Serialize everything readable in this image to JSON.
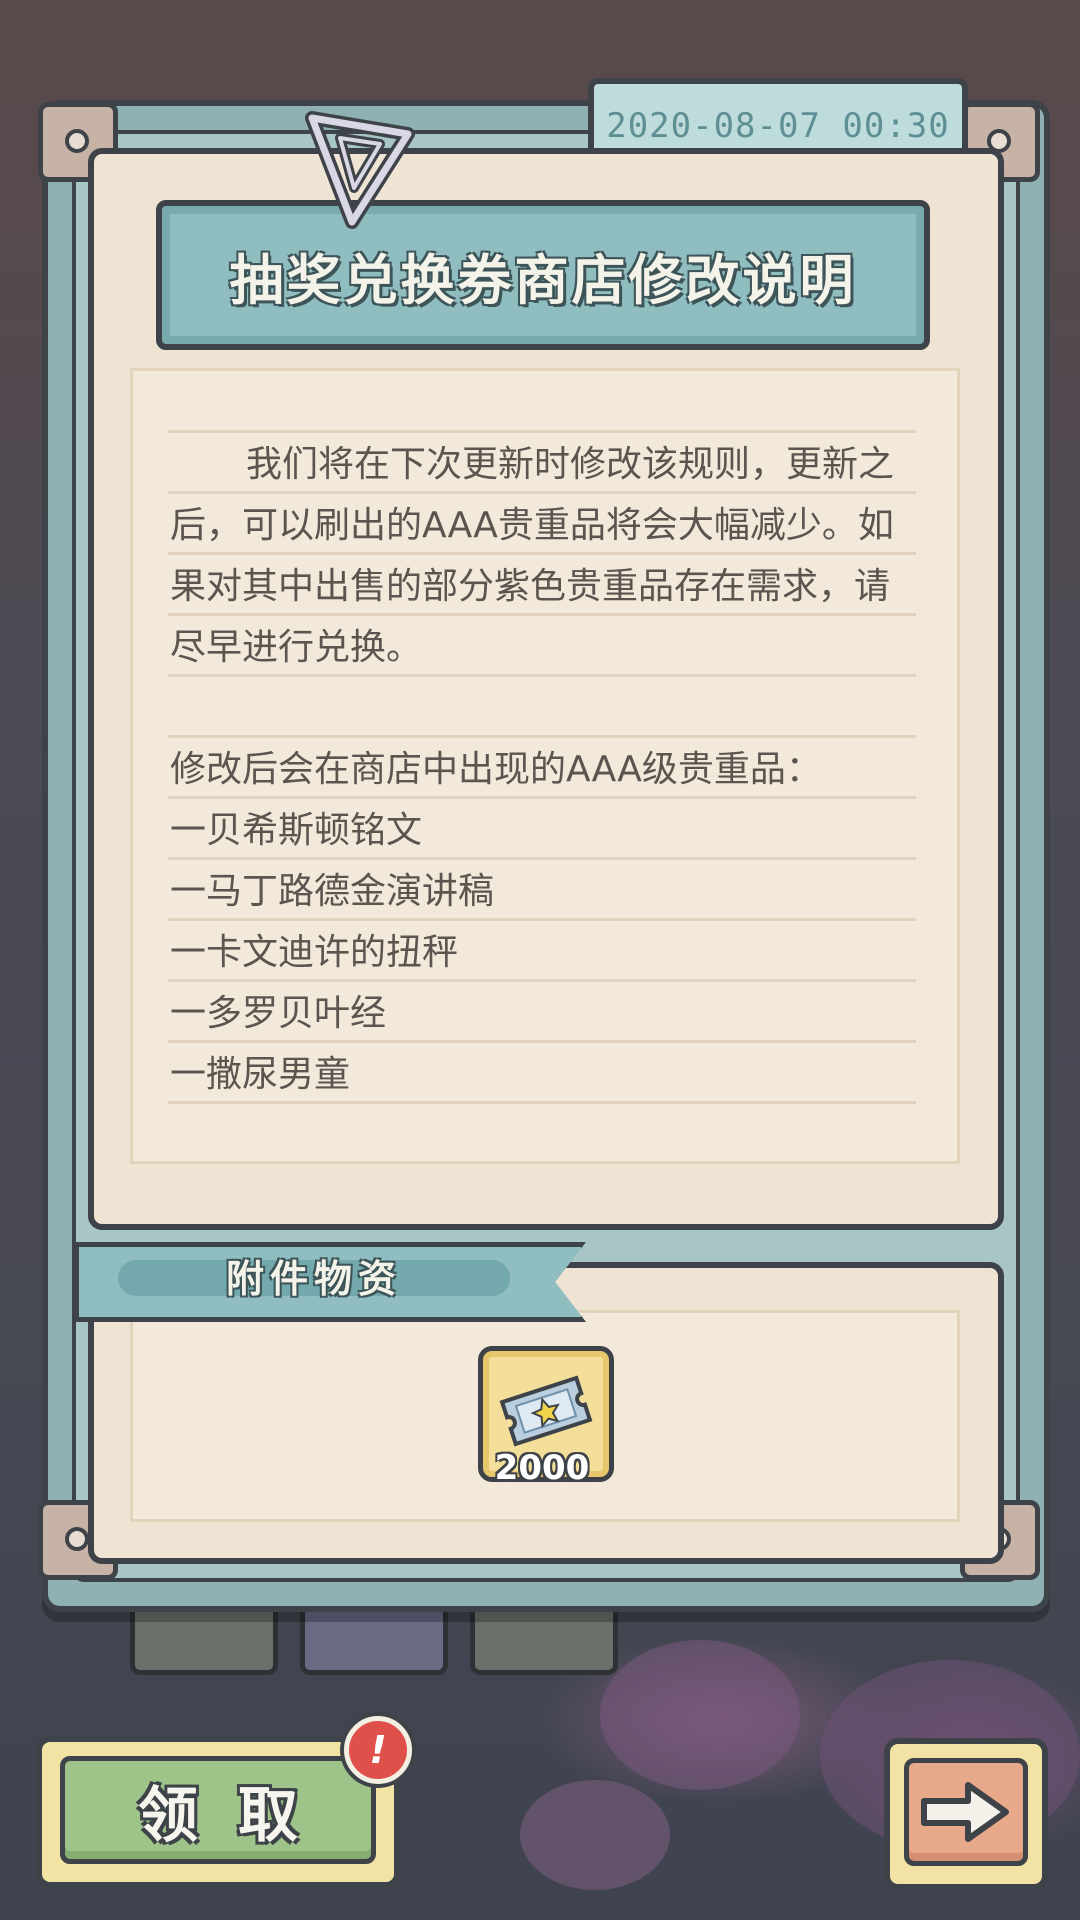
{
  "mail": {
    "date": "2020-08-07  00:30",
    "title": "抽奖兑换券商店修改说明",
    "body": {
      "para1": [
        "我们将在下次更新时修改该规则，更新之",
        "后，可以刷出的AAA贵重品将会大幅减少。如",
        "果对其中出售的部分紫色贵重品存在需求，请",
        "尽早进行兑换。"
      ],
      "list_heading": "修改后会在商店中出现的AAA级贵重品：",
      "list_items": [
        "一贝希斯顿铭文",
        "一马丁路德金演讲稿",
        "一卡文迪许的扭秤",
        "一多罗贝叶经",
        "一撒尿男童"
      ]
    },
    "attachments": {
      "label": "附件物资",
      "items": [
        {
          "icon": "lottery-ticket-icon",
          "count": "2000"
        }
      ]
    }
  },
  "actions": {
    "claim_label": "领取",
    "alert_mark": "!",
    "next_icon": "arrow-right-icon"
  },
  "colors": {
    "frame": "#8fb1b3",
    "paper": "#efe4d3",
    "banner": "#8fbdc0",
    "claim": "#9ec48a",
    "next": "#e8a98a",
    "alert": "#e0504a"
  }
}
